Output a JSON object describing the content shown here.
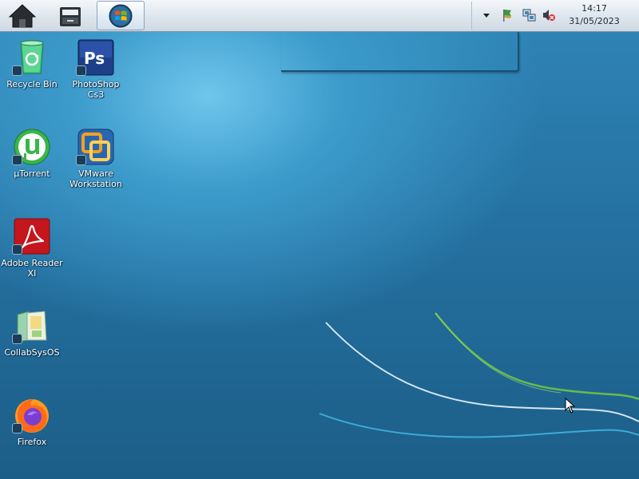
{
  "taskbar": {
    "home_icon": "home-icon",
    "files_icon": "file-manager-icon",
    "start_icon": "windows-start-orb-icon"
  },
  "tray": {
    "icons": [
      "tray-expand-arrow-icon",
      "flag-icon",
      "network-icon",
      "volume-muted-icon"
    ],
    "time": "14:17",
    "date": "31/05/2023"
  },
  "desktop": {
    "icons": [
      {
        "label": "Recycle Bin",
        "icon": "recycle-bin-icon"
      },
      {
        "label": "PhotoShop Cs3",
        "icon": "photoshop-icon"
      },
      {
        "label": "µTorrent",
        "icon": "utorrent-icon"
      },
      {
        "label": "VMware Workstation",
        "icon": "vmware-icon"
      },
      {
        "label": "Adobe Reader XI",
        "icon": "adobe-reader-icon"
      },
      {
        "label": "CollabSysOS",
        "icon": "folder-icon"
      },
      {
        "label": "Firefox",
        "icon": "firefox-icon"
      }
    ]
  },
  "colors": {
    "desktop_blue": "#236e9d",
    "curve_green": "#6cc04a",
    "curve_white": "#e8f4fa",
    "curve_cyan": "#3fb4e0"
  }
}
